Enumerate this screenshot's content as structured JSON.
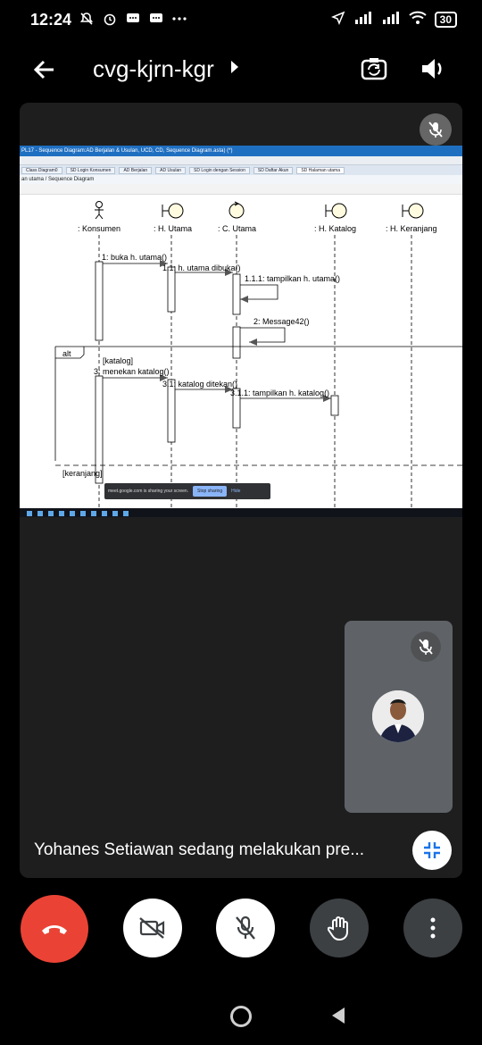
{
  "status": {
    "time": "12:24",
    "battery": "30"
  },
  "meeting": {
    "code": "cvg-kjrn-kgr"
  },
  "presentation": {
    "window_title": "PL17 - Sequence Diagram:AD Berjalan & Usulan, UCD, CD, Sequence Diagram.asta) (*)",
    "tabs": [
      "Class Diagram0",
      "SD Login Konsumen",
      "AD Berjalan",
      "AD Usulan",
      "SD Login dengan Session",
      "SD Daftar Akun",
      "SD Halaman utama"
    ],
    "breadcrumb": "an utama / Sequence Diagram",
    "lifelines": [
      ": Konsumen",
      ": H. Utama",
      ": C. Utama",
      ": H. Katalog",
      ": H. Keranjang"
    ],
    "messages": [
      "1: buka h. utama()",
      "1.1: h. utama dibuka()",
      "1.1.1: tampilkan h. utama()",
      "2: Message42()",
      "3: menekan katalog()",
      "3.1: katalog ditekan()",
      "3.1.1: tampilkan h. katalog()"
    ],
    "fragment_label": "alt",
    "guard_katalog": "[katalog]",
    "guard_keranjang": "[keranjang]",
    "share_notice": "meet.google.com is sharing your screen.",
    "stop_sharing": "Stop sharing",
    "hide": "Hide"
  },
  "presenter_text": "Yohanes Setiawan sedang melakukan pre...",
  "colors": {
    "end_call": "#ea4335",
    "tile_bg": "#1e1e1e",
    "self_tile_bg": "#5f6368",
    "share_accent": "#8ab4f8"
  },
  "icons": [
    "back-arrow-icon",
    "chevron-right-icon",
    "camera-flip-icon",
    "speaker-icon",
    "mic-off-icon",
    "collapse-icon",
    "end-call-icon",
    "camera-off-icon",
    "hand-raise-icon",
    "more-vert-icon"
  ]
}
